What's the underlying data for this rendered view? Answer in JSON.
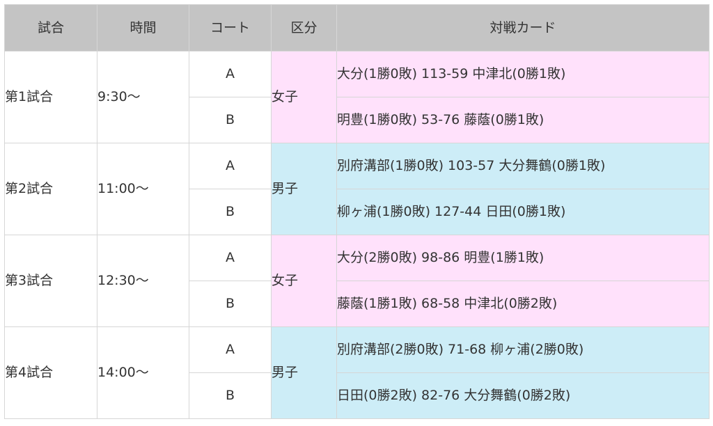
{
  "header": {
    "game": "試合",
    "time": "時間",
    "court": "コート",
    "division": "区分",
    "card": "対戦カード"
  },
  "colors": {
    "header_bg": "#c4c4c4",
    "women_bg": "#ffe1fb",
    "men_bg": "#cdedf7",
    "border": "#d6d6d6"
  },
  "rows": [
    {
      "game": "第1試合",
      "time": "9:30〜",
      "division": "女子",
      "matches": [
        {
          "court": "A",
          "card": "大分(1勝0敗) 113-59 中津北(0勝1敗)"
        },
        {
          "court": "B",
          "card": "明豊(1勝0敗) 53-76 藤蔭(0勝1敗)"
        }
      ]
    },
    {
      "game": "第2試合",
      "time": "11:00〜",
      "division": "男子",
      "matches": [
        {
          "court": "A",
          "card": "別府溝部(1勝0敗) 103-57 大分舞鶴(0勝1敗)"
        },
        {
          "court": "B",
          "card": "柳ヶ浦(1勝0敗) 127-44 日田(0勝1敗)"
        }
      ]
    },
    {
      "game": "第3試合",
      "time": "12:30〜",
      "division": "女子",
      "matches": [
        {
          "court": "A",
          "card": "大分(2勝0敗) 98-86 明豊(1勝1敗)"
        },
        {
          "court": "B",
          "card": "藤蔭(1勝1敗) 68-58 中津北(0勝2敗)"
        }
      ]
    },
    {
      "game": "第4試合",
      "time": "14:00〜",
      "division": "男子",
      "matches": [
        {
          "court": "A",
          "card": "別府溝部(2勝0敗) 71-68 柳ヶ浦(2勝0敗)"
        },
        {
          "court": "B",
          "card": "日田(0勝2敗) 82-76 大分舞鶴(0勝2敗)"
        }
      ]
    }
  ]
}
